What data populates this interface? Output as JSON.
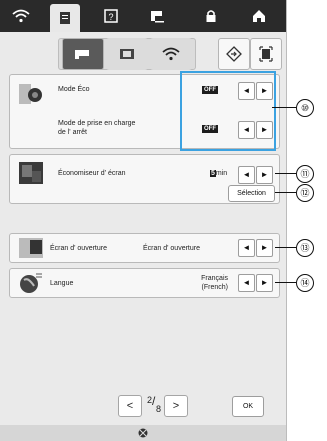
{
  "tabs": [
    {
      "name": "wifi-tab",
      "icon": "wifi-icon"
    },
    {
      "name": "settings-tab",
      "icon": "document-icon"
    },
    {
      "name": "help-tab",
      "icon": "help-icon"
    },
    {
      "name": "sewing-tab",
      "icon": "machine-icon"
    },
    {
      "name": "lock-tab",
      "icon": "lock-icon"
    },
    {
      "name": "home-tab",
      "icon": "home-icon"
    }
  ],
  "rows": {
    "eco": {
      "label": "Mode Éco",
      "value": "OFF"
    },
    "shutoff": {
      "label_line1": "Mode de prise en charge",
      "label_line2": "de l' arrêt",
      "value": "OFF"
    },
    "screensaver": {
      "label": "Économiseur d' écran",
      "value_num": "5",
      "value_unit": "min",
      "select_label": "Sélection"
    },
    "opening": {
      "label": "Écran d' ouverture",
      "value": "Écran d' ouverture"
    },
    "language": {
      "label": "Langue",
      "value_line1": "Français",
      "value_line2": "(French)"
    }
  },
  "arrows": {
    "left": "◄",
    "right": "►"
  },
  "callouts": [
    "⑩",
    "⑪",
    "⑫",
    "⑬",
    "⑭"
  ],
  "pager": {
    "prev": "<",
    "page": "2",
    "total": "8",
    "next": ">",
    "ok": "OK"
  },
  "colors": {
    "highlight": "#3ba2e1",
    "tab_bar": "#2a2a2a"
  }
}
